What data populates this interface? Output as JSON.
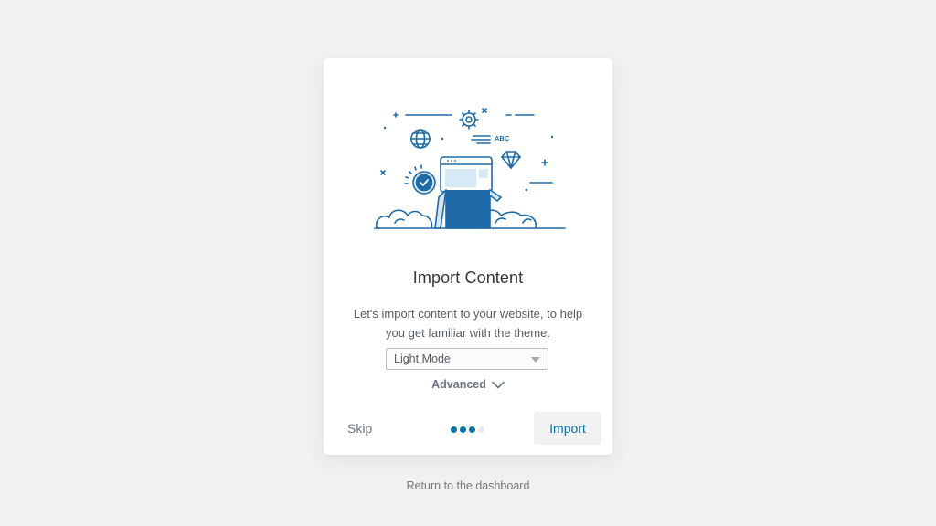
{
  "card": {
    "title": "Import Content",
    "description": "Let's import content to your website, to help you get familiar with the theme.",
    "illustration_icon": "import-content-illustration",
    "illustration_label": "ABC"
  },
  "mode_select": {
    "selected": "Light Mode"
  },
  "advanced": {
    "label": "Advanced",
    "icon": "chevron-down-icon"
  },
  "footer": {
    "skip_label": "Skip",
    "import_label": "Import",
    "steps_total": 4,
    "steps_completed": 3
  },
  "return_link": "Return to the dashboard",
  "colors": {
    "accent": "#0073aa",
    "illustration_blue": "#1e6ba8",
    "light_blue": "#d6e9f6",
    "background": "#f1f1f1"
  }
}
